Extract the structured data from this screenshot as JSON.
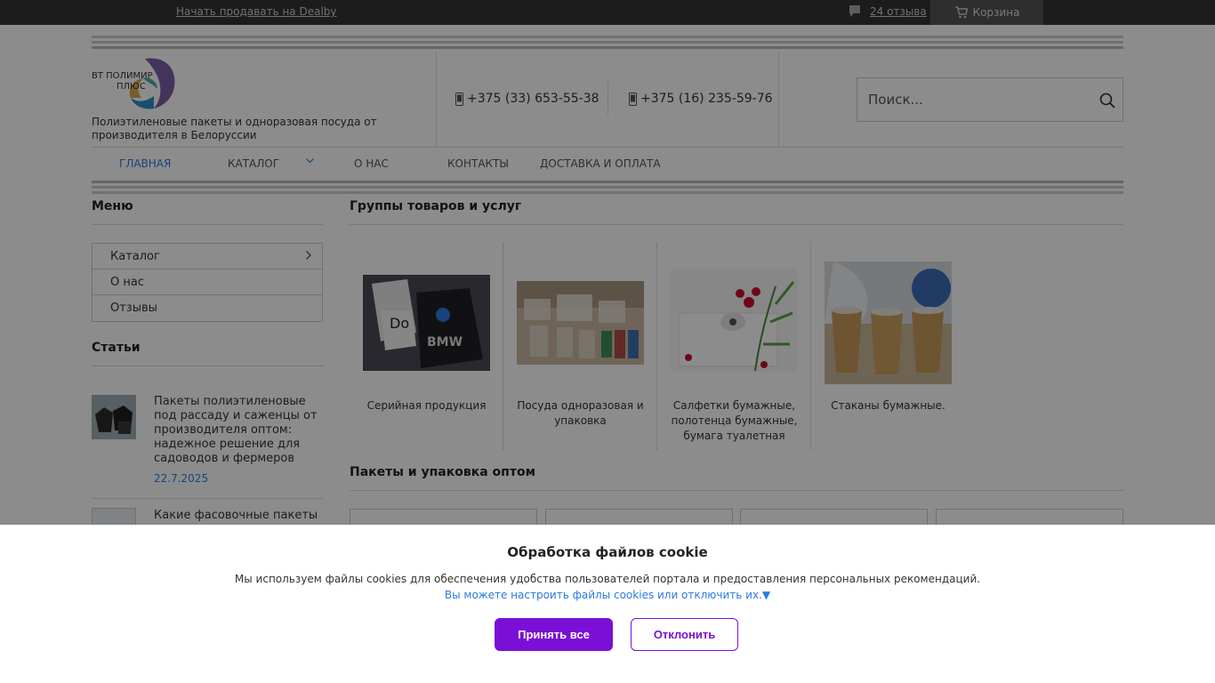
{
  "topbar": {
    "sell_link": "Начать продавать на Dealby",
    "reviews_label": "24 отзыва",
    "cart_label": "Корзина"
  },
  "header": {
    "logo_text_line1": "ВТ ПОЛИМИР",
    "logo_text_line2": "ПЛЮС",
    "tagline": "Полиэтиленовые пакеты и одноразовая посуда от производителя в Белоруссии",
    "phone1": "+375 (33) 653-55-38",
    "phone2": "+375 (16) 235-59-76",
    "search_placeholder": "Поиск..."
  },
  "nav": {
    "items": [
      {
        "label": "ГЛАВНАЯ",
        "active": true
      },
      {
        "label": "КАТАЛОГ"
      },
      {
        "label": "О НАС"
      },
      {
        "label": "КОНТАКТЫ"
      },
      {
        "label": "ДОСТАВКА И ОПЛАТА"
      }
    ]
  },
  "sidebar": {
    "menu_title": "Меню",
    "menu_items": [
      "Каталог",
      "О нас",
      "Отзывы"
    ],
    "articles_title": "Статьи",
    "articles": [
      {
        "title": "Пакеты полиэтиленовые под рассаду и саженцы от производителя оптом: надежное решение для садоводов и фермеров",
        "date": "22.7.2025"
      },
      {
        "title": "Какие фасовочные пакеты"
      }
    ]
  },
  "main": {
    "groups_title": "Группы товаров и услуг",
    "groups": [
      {
        "caption": "Серийная продукция"
      },
      {
        "caption": "Посуда одноразовая и упаковка"
      },
      {
        "caption": "Салфетки бумажные, полотенца бумажные, бумага туалетная"
      },
      {
        "caption": "Стаканы бумажные."
      }
    ],
    "packages_title": "Пакеты и упаковка оптом"
  },
  "cookie": {
    "title": "Обработка файлов cookie",
    "text": "Мы используем файлы cookies для обеспечения удобства пользователей портала и предоставления персональных рекомендаций.",
    "settings_link": "Вы можете настроить файлы cookies или отключить их.▼",
    "accept": "Принять все",
    "decline": "Отклонить"
  },
  "colors": {
    "accent": "#7a0fd6",
    "link": "#2a7ae2",
    "topbar": "#333333"
  }
}
